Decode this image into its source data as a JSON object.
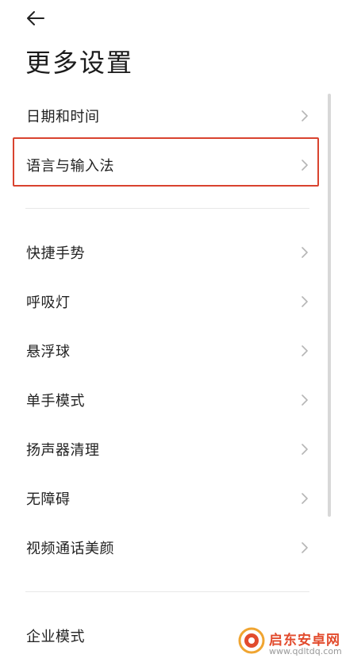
{
  "header": {
    "back_icon": "arrow-left-icon",
    "title": "更多设置"
  },
  "settings": {
    "group1": [
      {
        "label": "日期和时间",
        "icon": "chevron-right-icon"
      },
      {
        "label": "语言与输入法",
        "icon": "chevron-right-icon",
        "highlighted": true
      }
    ],
    "group2": [
      {
        "label": "快捷手势",
        "icon": "chevron-right-icon"
      },
      {
        "label": "呼吸灯",
        "icon": "chevron-right-icon"
      },
      {
        "label": "悬浮球",
        "icon": "chevron-right-icon"
      },
      {
        "label": "单手模式",
        "icon": "chevron-right-icon"
      },
      {
        "label": "扬声器清理",
        "icon": "chevron-right-icon"
      },
      {
        "label": "无障碍",
        "icon": "chevron-right-icon"
      },
      {
        "label": "视频通话美颜",
        "icon": "chevron-right-icon"
      }
    ],
    "group3": [
      {
        "label": "企业模式",
        "icon": "chevron-right-icon"
      }
    ]
  },
  "highlight_color": "#d9432f",
  "watermark": {
    "name": "启东安卓网",
    "url": "www.qdltdq.com",
    "color": "#e24b2d"
  }
}
